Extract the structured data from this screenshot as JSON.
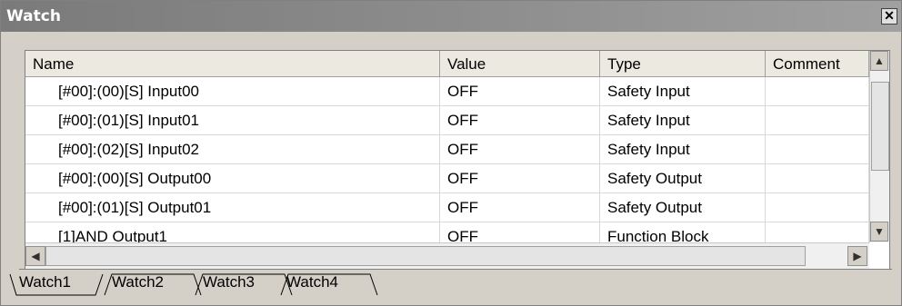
{
  "window": {
    "title": "Watch",
    "close_icon": "close-icon"
  },
  "table": {
    "columns": [
      "Name",
      "Value",
      "Type",
      "Comment"
    ],
    "rows": [
      {
        "name": "[#00]:(00)[S] Input00",
        "value": "OFF",
        "type": "Safety Input",
        "comment": ""
      },
      {
        "name": "[#00]:(01)[S] Input01",
        "value": "OFF",
        "type": "Safety Input",
        "comment": ""
      },
      {
        "name": "[#00]:(02)[S] Input02",
        "value": "OFF",
        "type": "Safety Input",
        "comment": ""
      },
      {
        "name": "[#00]:(00)[S] Output00",
        "value": "OFF",
        "type": "Safety Output",
        "comment": ""
      },
      {
        "name": "[#00]:(01)[S] Output01",
        "value": "OFF",
        "type": "Safety Output",
        "comment": ""
      },
      {
        "name": "[1]AND Output1",
        "value": "OFF",
        "type": "Function Block",
        "comment": ""
      }
    ]
  },
  "tabs": [
    "Watch1",
    "Watch2",
    "Watch3",
    "Watch4"
  ],
  "active_tab": "Watch1"
}
